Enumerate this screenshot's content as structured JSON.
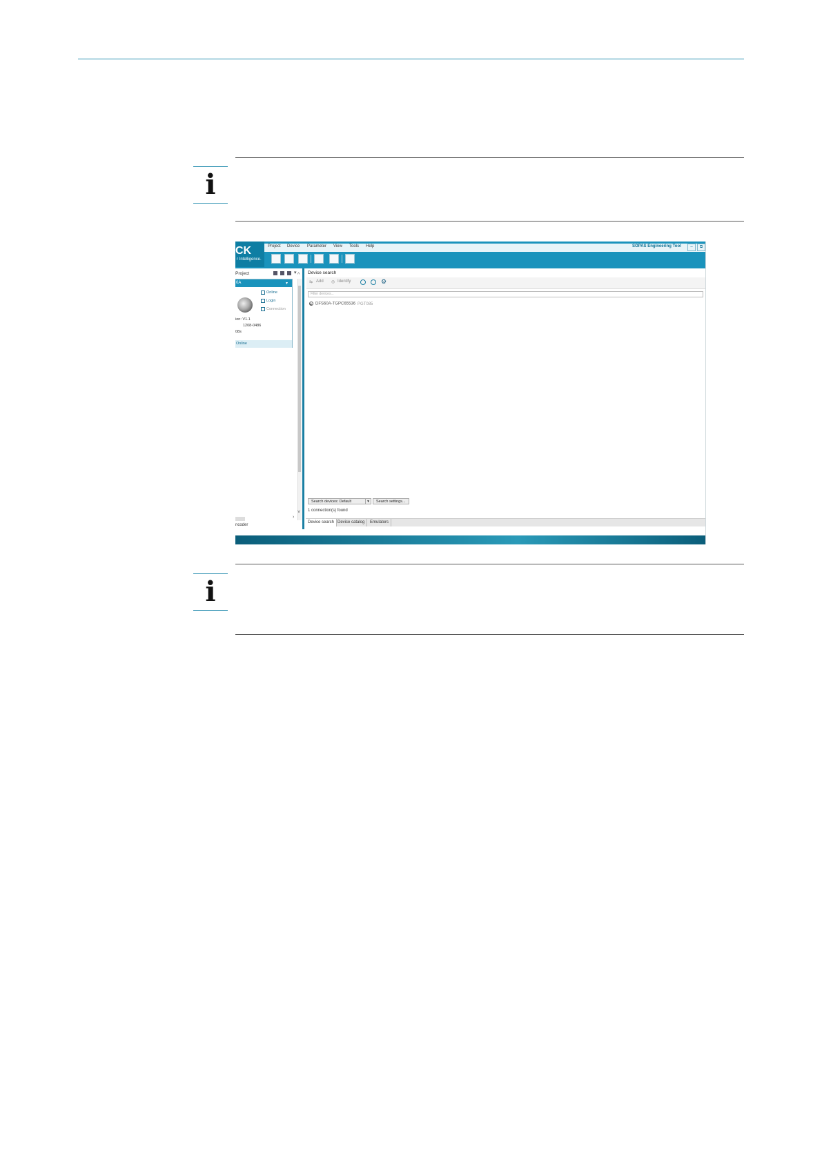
{
  "screenshot": {
    "logo": {
      "main": "CK",
      "sub": "r Intelligence."
    },
    "menu": [
      "Project",
      "Device",
      "Parameter",
      "View",
      "Tools",
      "Help"
    ],
    "app_title": "SOPAS Engineering Tool",
    "window_buttons": [
      "–",
      "⧉"
    ],
    "left_panel": {
      "title": "Project",
      "card_title": "0A",
      "actions": [
        "Online",
        "Login",
        "Connection"
      ],
      "version_label": "ion: V1.1",
      "serial": "1208-0486",
      "line3": "08s",
      "status": "Online",
      "footer": "ncoder"
    },
    "main_panel": {
      "title": "Device search",
      "toolbar": {
        "add": "Add",
        "identify": "Identify"
      },
      "filter_placeholder": "Filter devices...",
      "device": {
        "name": "DFS60A-TGPC65536",
        "id": "PGT085"
      },
      "search_dropdown": "Search devices: Default",
      "search_settings": "Search settings...",
      "connections_found": "1 connection(s) found",
      "tabs": [
        "Device search",
        "Device catalog",
        "Emulators"
      ]
    }
  },
  "colors": {
    "accent": "#1a93bc",
    "rule": "#2a8fb0"
  }
}
